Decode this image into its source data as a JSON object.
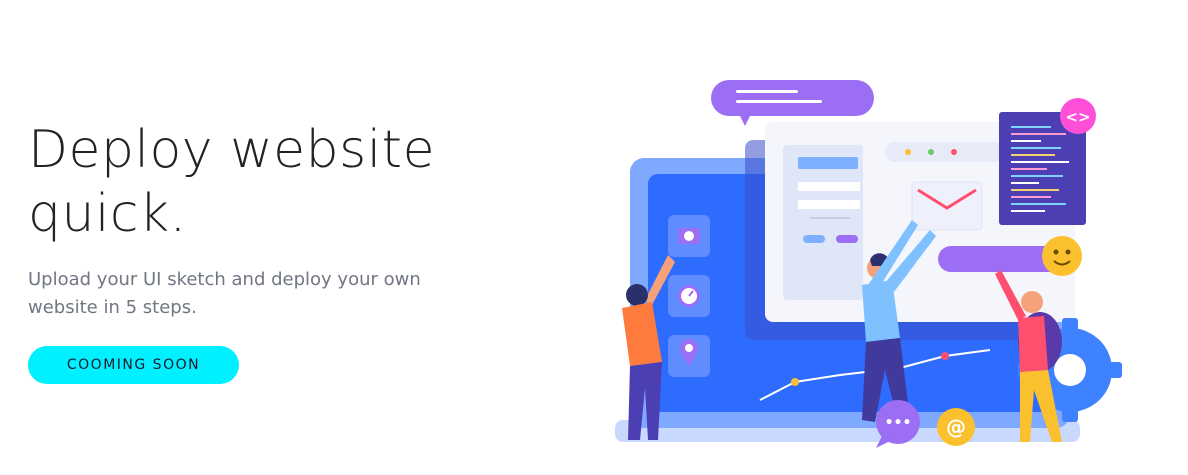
{
  "hero": {
    "title_line1": "Deploy website",
    "title_line2": "quick.",
    "subtitle": "Upload your UI sketch and deploy your own website in 5 steps.",
    "cta_label": "COOMING SOON"
  },
  "illustration": {
    "code_badge": "<>",
    "at_badge": "@",
    "chat_badge": "•••"
  },
  "colors": {
    "accent": "#00f0ff",
    "purple": "#9b6ef3",
    "blue": "#2d6cff",
    "dark_panel": "#4b3fb3",
    "pink": "#ff4fd8",
    "yellow": "#fbc02d"
  }
}
